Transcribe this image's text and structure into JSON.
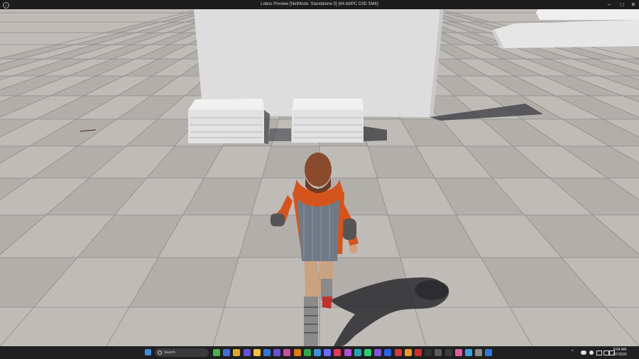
{
  "window": {
    "title": "Lobos Preview [NetMode: Standalone 0] (64-bit/PC D3D SM6)",
    "app_icon_glyph": "U",
    "minimize_glyph": "–",
    "maximize_glyph": "□",
    "close_glyph": "✕"
  },
  "scene": {
    "floor_color": "#bdbab6",
    "tile_line_color": "#8a8886",
    "wall_color": "#dcdcdc",
    "character": {
      "hair_color": "#8a4a2c",
      "hoodie_color": "#d5541e",
      "vest_color": "#6f7a86",
      "pants_color": "#c9a27f"
    }
  },
  "taskbar": {
    "start_icon": "windows-start-icon",
    "search_placeholder": "Search",
    "clock_time": "8:04 AM",
    "clock_date": "1/7/2026",
    "tray_chevron": "^",
    "pinned_colors": [
      "#4caf50",
      "#3f6fd8",
      "#e0a82e",
      "#6b4fd6",
      "#f0c341",
      "#2f78d6",
      "#6b4fd6",
      "#c94f9e",
      "#e07a1b",
      "#2fa84f",
      "#3b8fe0",
      "#6b6bff",
      "#e03b5a",
      "#b04fd6",
      "#2aa0b8",
      "#2fcf6a",
      "#7d57d6",
      "#2862e8",
      "#d33b3b",
      "#e89a2b",
      "#d02f2f",
      "#333333",
      "#5a5a5a",
      "#3b3b3b",
      "#e45aa0",
      "#3b9fe0",
      "#8c8c8c",
      "#2f78d6"
    ]
  }
}
